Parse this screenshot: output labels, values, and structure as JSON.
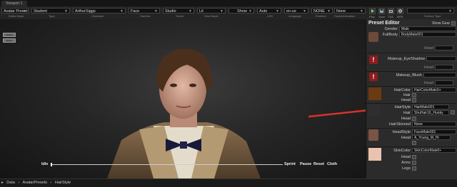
{
  "viewport_tab": "Viewport 1",
  "toolbar": {
    "dropdowns": [
      {
        "value": "Avatar Preset",
        "caption": "Editor Mode"
      },
      {
        "value": "Student",
        "caption": "Type"
      },
      {
        "value": "ArthurSiggs",
        "caption": "Character"
      },
      {
        "value": "Face",
        "caption": "Camera"
      },
      {
        "value": "Studio",
        "caption": "Scene"
      },
      {
        "value": "Lit",
        "caption": "View Mode"
      },
      {
        "value": "Show",
        "caption": ""
      },
      {
        "value": "Auto",
        "caption": "LOD"
      },
      {
        "value": "en-us",
        "caption": "Language"
      },
      {
        "value": "NONE",
        "caption": "Emotion"
      },
      {
        "value": "None",
        "caption": "Facial Animation"
      }
    ],
    "icons": [
      {
        "label": "Play",
        "icon": "play-icon"
      },
      {
        "label": "Save",
        "icon": "save-icon"
      },
      {
        "label": "TSA",
        "icon": "camera-icon"
      },
      {
        "label": "MPA",
        "icon": "gear-icon"
      }
    ],
    "surface_caption": "Surface Type"
  },
  "viewport": {
    "buttons": [
      "Sweep",
      "Reset"
    ],
    "scrubber": {
      "left": "Idle",
      "right": [
        "Sprint",
        "Pause",
        "Reset",
        "Cloth"
      ],
      "position": 0.0
    }
  },
  "panel": {
    "title": "Preset Editor",
    "show_gear": "Show Gear",
    "gender": {
      "label": "Gender",
      "value": "Male"
    },
    "full_body": {
      "label": "FullBody",
      "value": "BodyMale001"
    },
    "head_a": "Head",
    "makeup_eyeshadow": "Makeup_EyeShadow",
    "head_b": "Head",
    "makeup_blush": "Makeup_Blush",
    "head_c": "Head",
    "hair_color": {
      "label": "HairColor",
      "value": "HairColorMale0+"
    },
    "hair_a": "Hair",
    "head_d": "Head",
    "hair_style": {
      "label": "HairStyle",
      "value": "HairMale001"
    },
    "hair_field": {
      "label": "Hair",
      "value": "ShuHair16_Hunky"
    },
    "head_e": "Head",
    "hair_skinned": {
      "label": "HairSkinned",
      "value": "None"
    },
    "head_style": {
      "label": "HeadStyle",
      "value": "FaceMale001"
    },
    "head_field": {
      "label": "Head",
      "value": "A_Young_M_Hi"
    },
    "skin_color": {
      "label": "SkinColor",
      "value": "SkinColorMale0+"
    },
    "head_f": "Head",
    "arms": "Arms",
    "legs": "Legs"
  },
  "breadcrumb": [
    "Data",
    "AvatarPresets",
    "HairStyle"
  ],
  "colors": {
    "arrow": "#d8322c",
    "hair_swatch": "#6a3a12",
    "skin_swatch": "#e9c3ae",
    "warn": "#8e1c1c"
  }
}
